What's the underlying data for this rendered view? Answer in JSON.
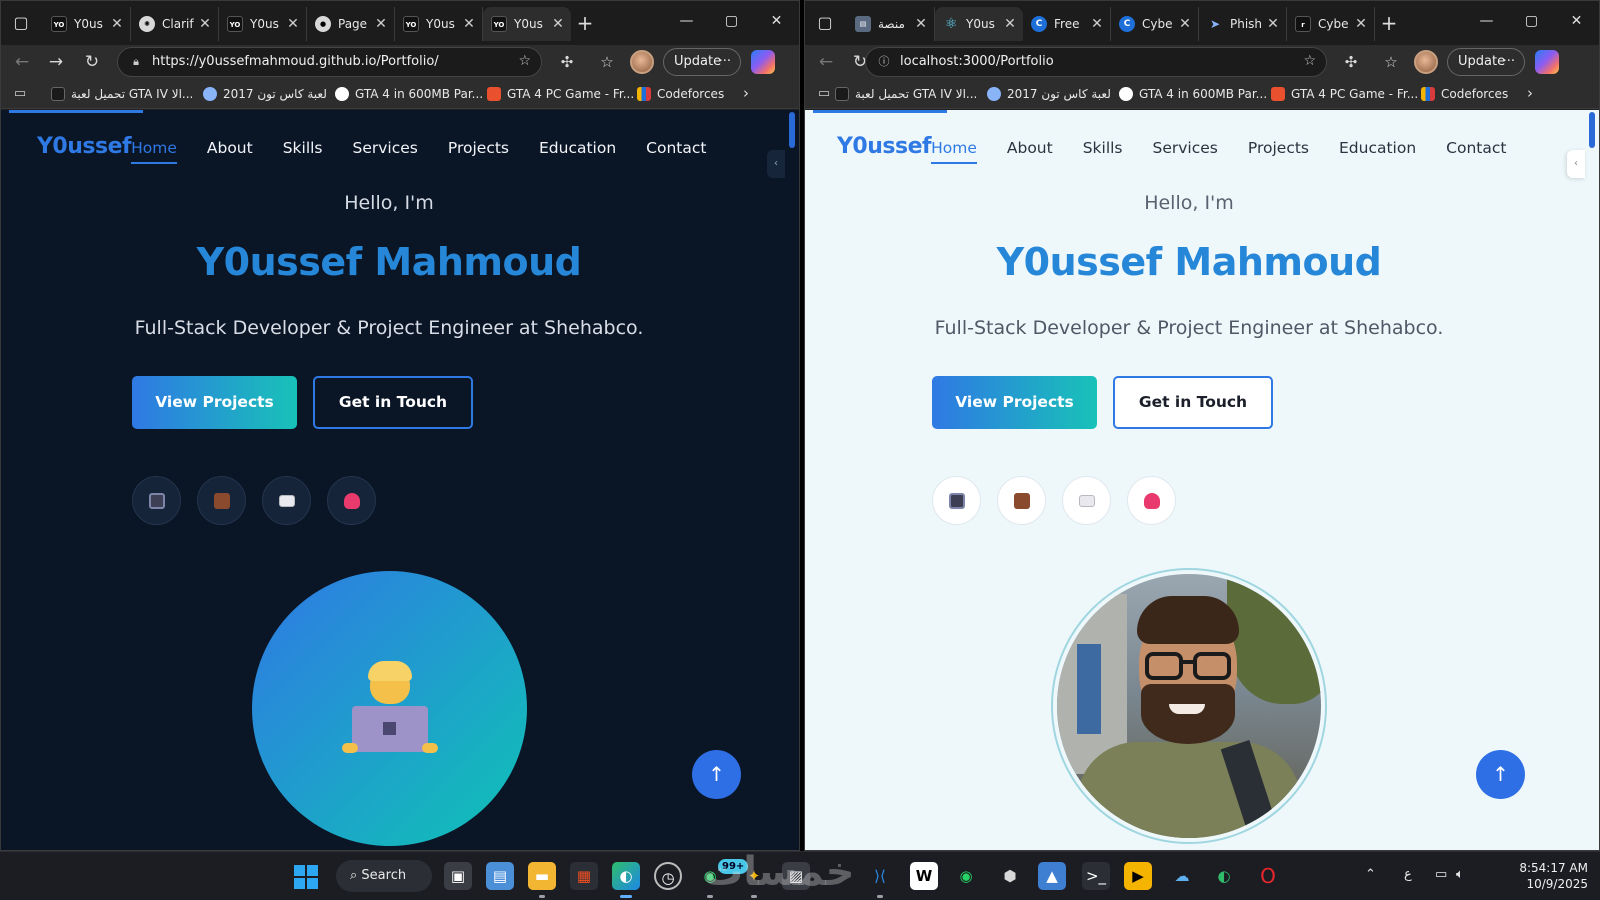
{
  "left_window": {
    "tabs": [
      {
        "favicon": "YO",
        "title": "Y0us"
      },
      {
        "favicon": "clarifai-icon",
        "title": "Clarif"
      },
      {
        "favicon": "YO",
        "title": "Y0us"
      },
      {
        "favicon": "github-icon",
        "title": "Page"
      },
      {
        "favicon": "YO",
        "title": "Y0us"
      },
      {
        "favicon": "YO",
        "title": "Y0us"
      }
    ],
    "url": "https://y0ussefmahmoud.github.io/Portfolio/",
    "theme": "dark"
  },
  "right_window": {
    "tabs": [
      {
        "favicon": "page-icon",
        "title": "منصة"
      },
      {
        "favicon": "react-icon",
        "title": "Y0us"
      },
      {
        "favicon": "C",
        "title": "Free"
      },
      {
        "favicon": "C",
        "title": "Cybe"
      },
      {
        "favicon": "telegram-icon",
        "title": "Phish"
      },
      {
        "favicon": "r",
        "title": "Cybe"
      }
    ],
    "url": "localhost:3000/Portfolio",
    "theme": "light"
  },
  "toolbar": {
    "update_label": "Update"
  },
  "bookmarks": [
    {
      "label": "تحميل لعبة GTA IV الا...",
      "color": "#1a1a1a"
    },
    {
      "label": "لعبة كاس تون 2017",
      "color": "#8ab4f8"
    },
    {
      "label": "GTA 4 in 600MB Par...",
      "color": "#ffffff"
    },
    {
      "label": "GTA 4 PC Game - Fr...",
      "color": "#e8502e"
    },
    {
      "label": "Codeforces",
      "color": "#f5b400"
    }
  ],
  "site": {
    "logo": "Y0ussef",
    "nav": [
      "Home",
      "About",
      "Skills",
      "Services",
      "Projects",
      "Education",
      "Contact"
    ],
    "hello": "Hello, I'm",
    "name": "Y0ussef Mahmoud",
    "tagline": "Full-Stack Developer & Project Engineer at Shehabco.",
    "primary_cta": "View Projects",
    "secondary_cta": "Get in Touch",
    "socials": [
      "phone-icon",
      "briefcase-icon",
      "envelope-icon",
      "heart-icon"
    ],
    "accent_color": "#2f79e4",
    "gradient_end": "#18c2b8"
  },
  "taskbar": {
    "search_label": "Search",
    "notification_badge": "99+",
    "time": "8:54:17 AM",
    "date": "10/9/2025",
    "input_language": "ع"
  }
}
